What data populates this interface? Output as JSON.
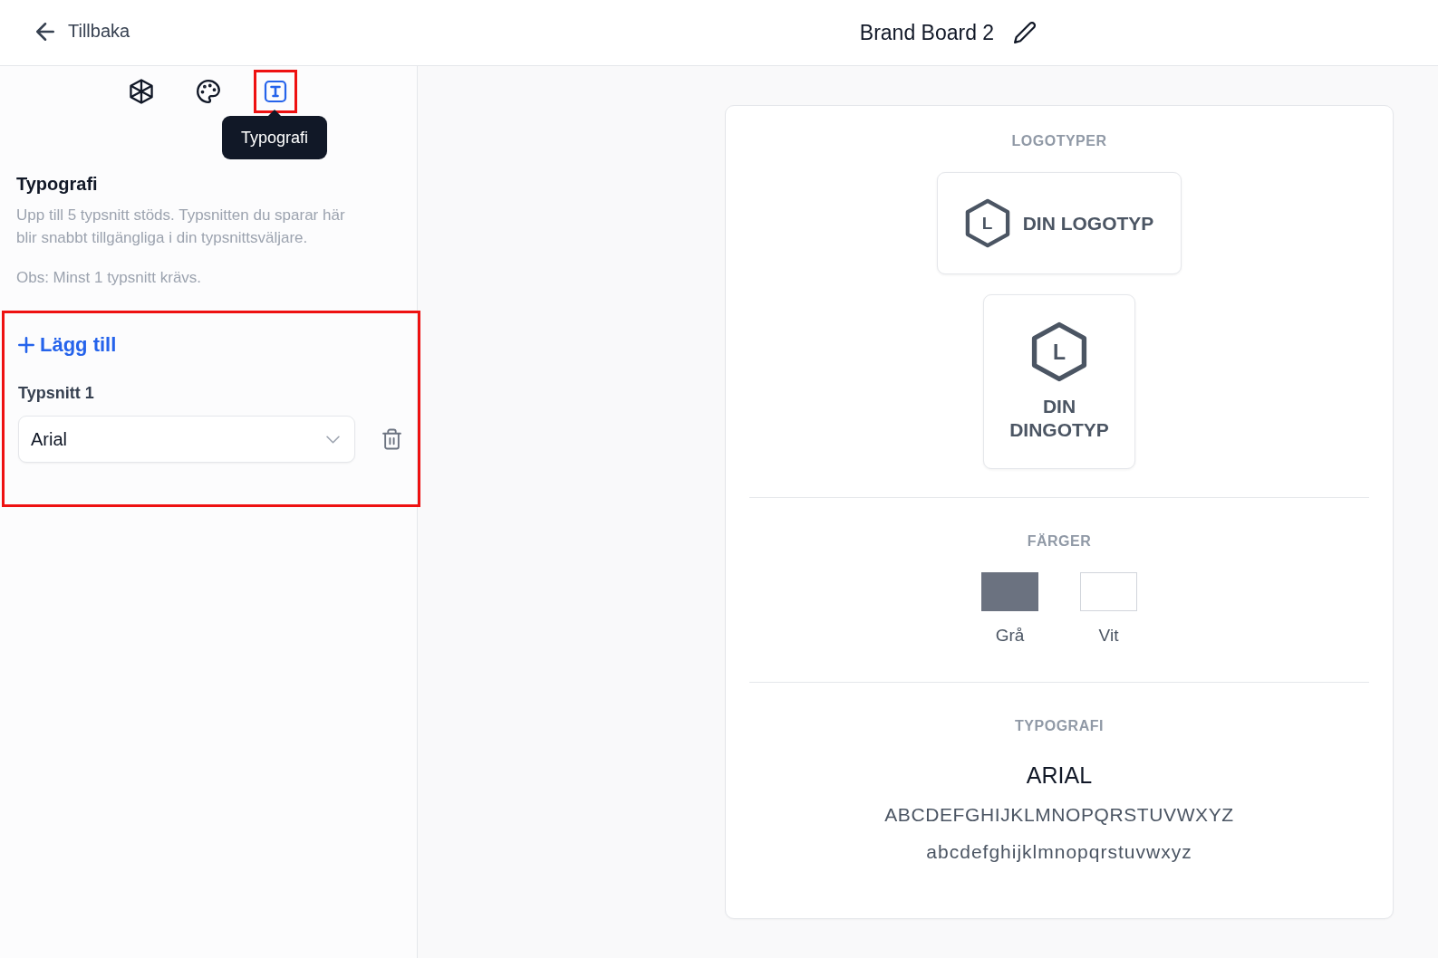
{
  "header": {
    "back_label": "Tillbaka",
    "title": "Brand Board 2"
  },
  "sidebar": {
    "tabs": [
      {
        "kind": "logo",
        "selected": false,
        "highlighted": false
      },
      {
        "kind": "palette",
        "selected": false,
        "highlighted": false
      },
      {
        "kind": "type",
        "selected": true,
        "highlighted": true
      }
    ],
    "tooltip": "Typografi",
    "section": {
      "title": "Typografi",
      "description": "Upp till 5 typsnitt stöds. Typsnitten du sparar här blir snabbt tillgängliga i din typsnittsväljare.",
      "note": "Obs: Minst 1 typsnitt krävs."
    },
    "fonts_panel": {
      "highlighted": true,
      "add_label": "Lägg till",
      "fonts": [
        {
          "label": "Typsnitt 1",
          "value": "Arial"
        }
      ]
    }
  },
  "preview": {
    "logos": {
      "heading": "LOGOTYPER",
      "items": [
        {
          "kind": "horizontal",
          "mark": "L",
          "text": "DIN LOGOTYP"
        },
        {
          "kind": "stacked",
          "mark": "L",
          "text": "DIN DINGOTYP"
        }
      ]
    },
    "colors": {
      "heading": "FÄRGER",
      "items": [
        {
          "name": "Grå",
          "color": "#6b7280"
        },
        {
          "name": "Vit",
          "color": "#ffffff"
        }
      ]
    },
    "typography": {
      "heading": "TYPOGRAFI",
      "fonts": [
        {
          "name": "ARIAL",
          "uppercase": "ABCDEFGHIJKLMNOPQRSTUVWXYZ",
          "lowercase": "abcdefghijklmnopqrstuvwxyz"
        }
      ]
    }
  }
}
